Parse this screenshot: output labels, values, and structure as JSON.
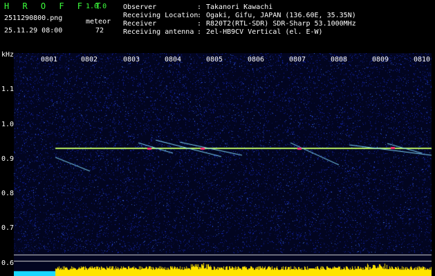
{
  "app": {
    "title": "H R O F F T",
    "version": "1.0.0",
    "filename": "2511290800.png",
    "datetime": "25.11.29 08:00",
    "meteor_label": "meteor",
    "meteor_count": "72"
  },
  "info": [
    {
      "key": "Observer",
      "value": "Takanori Kawachi"
    },
    {
      "key": "Receiving Location",
      "value": "Ogaki, Gifu, JAPAN (136.60E, 35.35N)"
    },
    {
      "key": "Receiver",
      "value": "R820T2(RTL-SDR) SDR-Sharp 53.1000MHz"
    },
    {
      "key": "Receiving antenna",
      "value": "2el-HB9CV Vertical (el. E-W)"
    }
  ],
  "separator": ":",
  "axis": {
    "unit": "kHz",
    "y_labels": [
      "1.1",
      "1.0",
      "0.9",
      "0.8",
      "0.7",
      "0.6"
    ],
    "x_labels": [
      "0801",
      "0802",
      "0803",
      "0804",
      "0805",
      "0806",
      "0807",
      "0808",
      "0809",
      "0810"
    ]
  },
  "colors": {
    "background": "#000000",
    "noise": "#0a1a7a",
    "carrier": "#b8f060",
    "meteor": "#7fd8ff",
    "level": "#ffe400",
    "label_green": "#3cff3c"
  }
}
